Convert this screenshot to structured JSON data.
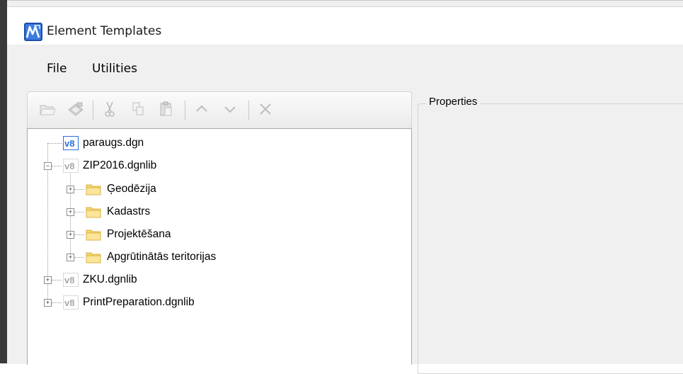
{
  "window": {
    "title": "Element Templates"
  },
  "menu": {
    "items": [
      "File",
      "Utilities"
    ]
  },
  "toolbar": {
    "buttons": [
      "open-folder-icon",
      "import-icon",
      "cut-icon",
      "copy-icon",
      "paste-icon",
      "move-up-icon",
      "move-down-icon",
      "delete-icon"
    ]
  },
  "tree": {
    "nodes": [
      {
        "label": "paraugs.dgn",
        "type": "dgn-file",
        "expanded": null,
        "active": true
      },
      {
        "label": "ZIP2016.dgnlib",
        "type": "dgnlib-file",
        "expanded": true
      },
      {
        "label": "Ģeodēzija",
        "type": "folder",
        "expanded": false
      },
      {
        "label": "Kadastrs",
        "type": "folder",
        "expanded": false
      },
      {
        "label": "Projektēšana",
        "type": "folder",
        "expanded": false
      },
      {
        "label": "Apgrūtinātās teritorijas",
        "type": "folder",
        "expanded": false
      },
      {
        "label": "ZKU.dgnlib",
        "type": "dgnlib-file",
        "expanded": false
      },
      {
        "label": "PrintPreparation.dgnlib",
        "type": "dgnlib-file",
        "expanded": false
      }
    ]
  },
  "properties": {
    "legend": "Properties"
  },
  "colors": {
    "accent": "#2a6fdc",
    "folder": "#f5d66b",
    "window_bg": "#f0f0f0"
  }
}
